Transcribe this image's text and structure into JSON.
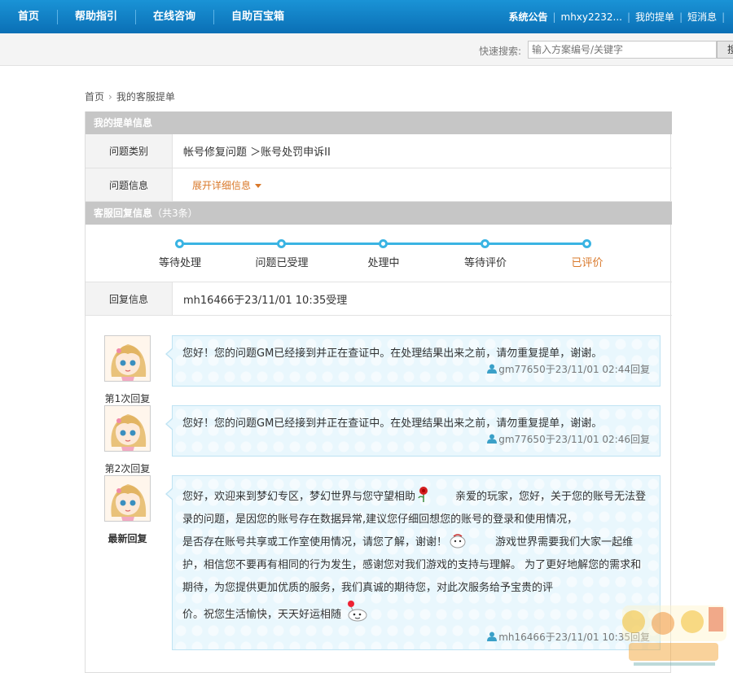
{
  "nav": {
    "items": [
      "首页",
      "帮助指引",
      "在线咨询",
      "自助百宝箱"
    ],
    "right": {
      "announcement": "系统公告",
      "username": "mhxy2232...",
      "my_tickets": "我的提单",
      "messages": "短消息"
    }
  },
  "search": {
    "label": "快速搜索:",
    "placeholder": "输入方案编号/关键字",
    "button": "搜"
  },
  "breadcrumb": {
    "home": "首页",
    "current": "我的客服提单"
  },
  "ticket": {
    "section_title": "我的提单信息",
    "category_label": "问题类别",
    "category_value": "帐号修复问题 ＞账号处罚申诉II",
    "info_label": "问题信息",
    "expand_label": "展开详细信息"
  },
  "service": {
    "section_title": "客服回复信息",
    "section_count": "（共3条）",
    "steps": [
      {
        "label": "等待处理",
        "active": false
      },
      {
        "label": "问题已受理",
        "active": false
      },
      {
        "label": "处理中",
        "active": false
      },
      {
        "label": "等待评价",
        "active": false
      },
      {
        "label": "已评价",
        "active": true
      }
    ],
    "reply_info_label": "回复信息",
    "reply_info_value": "mh16466于23/11/01 10:35受理"
  },
  "replies": [
    {
      "caption": "第1次回复",
      "text": "您好！您的问题GM已经接到并正在查证中。在处理结果出来之前，请勿重复提单，谢谢。",
      "meta": "gm77650于23/11/01 02:44回复"
    },
    {
      "caption": "第2次回复",
      "text": "您好！您的问题GM已经接到并正在查证中。在处理结果出来之前，请勿重复提单，谢谢。",
      "meta": "gm77650于23/11/01 02:46回复"
    },
    {
      "caption": "最新回复",
      "text_parts": [
        "您好，欢迎来到梦幻专区，梦幻世界与您守望相助",
        "亲爱的玩家，您好，关于您的账号无法登录的问题，是因您的账号存在数据异常,建议您仔细回想您的账号的登录和使用情况，",
        "是否存在账号共享或工作室使用情况，请您了解，谢谢！",
        "游戏世界需要我们大家一起维护，相信您不要再有相同的行为发生，感谢您对我们游戏的支持与理解。 为了更好地解您的需求和期待，为您提供更加优质的服务，我们真诚的期待您，对此次服务给予宝贵的评",
        "价。祝您生活愉快，天天好运相随"
      ],
      "meta": "mh16466于23/11/01 10:35回复"
    }
  ],
  "colors": {
    "nav_bg": "#0a6fb5",
    "accent_orange": "#d9782a",
    "progress_blue": "#3ab4e3",
    "header_gray": "#c6c6c6",
    "bubble_bg": "#e9f7fd"
  }
}
